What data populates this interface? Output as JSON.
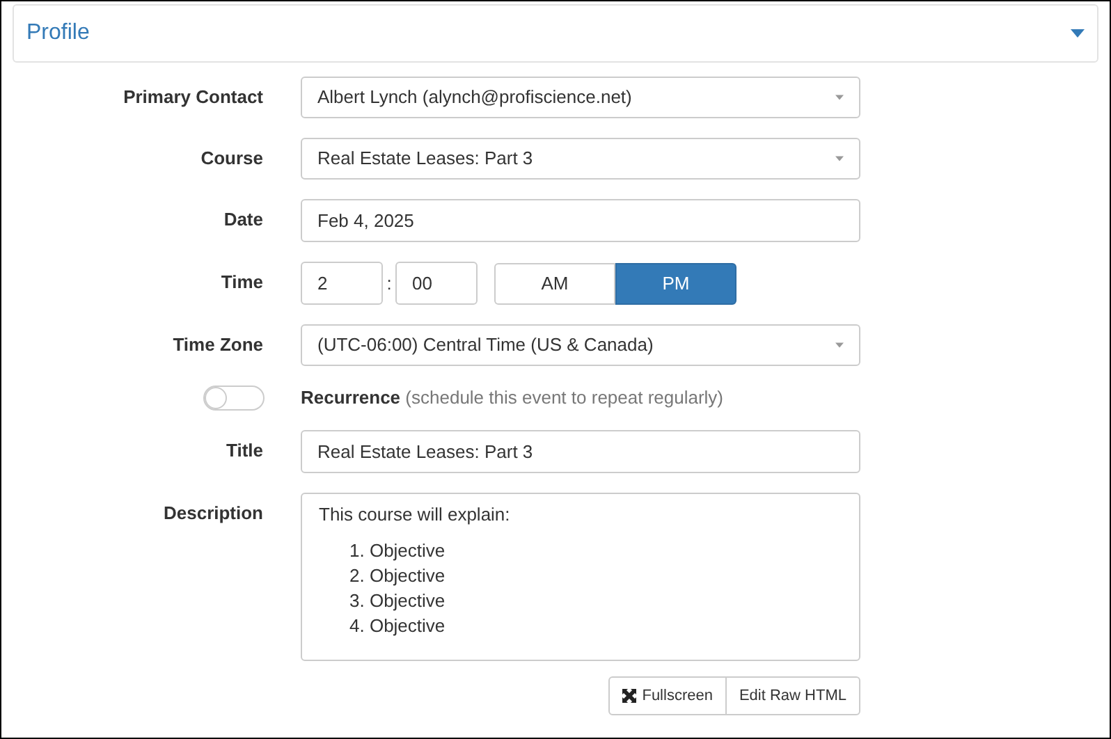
{
  "panel": {
    "title": "Profile",
    "expanded": true
  },
  "fields": [
    {
      "kind": "select",
      "label": "Primary Contact",
      "value": "Albert Lynch (alynch@profiscience.net)"
    },
    {
      "kind": "select",
      "label": "Course",
      "value": "Real Estate Leases: Part 3"
    },
    {
      "kind": "text",
      "label": "Date",
      "value": "Feb 4, 2025"
    },
    {
      "kind": "time",
      "label": "Time",
      "hour": "2",
      "separator": ":",
      "minute": "00",
      "meridiem": [
        {
          "label": "AM",
          "selected": false
        },
        {
          "label": "PM",
          "selected": true
        }
      ]
    },
    {
      "kind": "select",
      "label": "Time Zone",
      "value": "(UTC-06:00) Central Time (US & Canada)"
    },
    {
      "kind": "toggle",
      "label": "Recurrence",
      "hint": "(schedule this event to repeat regularly)",
      "on": false
    },
    {
      "kind": "text",
      "label": "Title",
      "value": "Real Estate Leases: Part 3"
    },
    {
      "kind": "editor",
      "label": "Description",
      "intro": "This course will explain:",
      "items": [
        "1. Objective",
        "2. Objective",
        "3. Objective",
        "4. Objective"
      ]
    }
  ],
  "editor_buttons": [
    {
      "kind": "fullscreen",
      "label": "Fullscreen"
    },
    {
      "kind": "plain",
      "label": "Edit Raw HTML"
    }
  ]
}
